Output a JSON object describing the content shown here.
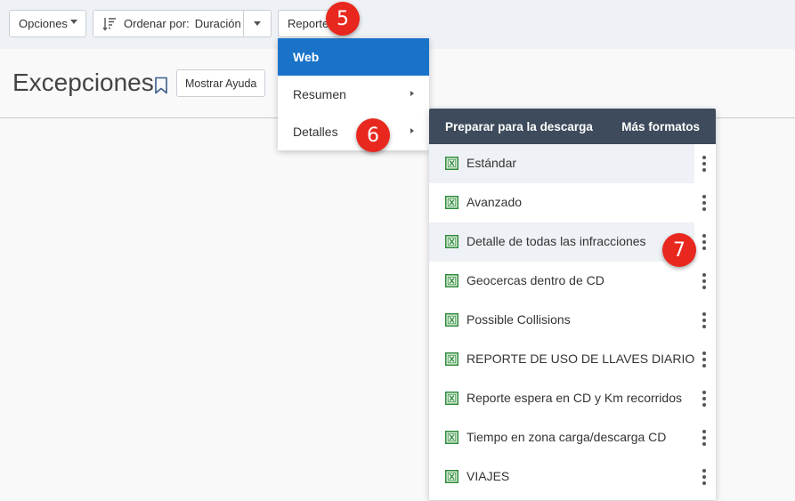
{
  "toolbar": {
    "opciones_label": "Opciones",
    "sort_prefix": "Ordenar por:",
    "sort_value": "Duración",
    "reportes_label": "Reportes"
  },
  "header": {
    "title": "Excepciones",
    "help_label": "Mostrar Ayuda"
  },
  "menu": {
    "items": [
      {
        "label": "Web"
      },
      {
        "label": "Resumen"
      },
      {
        "label": "Detalles"
      }
    ]
  },
  "submenu": {
    "header_left": "Preparar para la descarga",
    "header_right": "Más formatos",
    "items": [
      {
        "label": "Estándar"
      },
      {
        "label": "Avanzado"
      },
      {
        "label": "Detalle de todas las infracciones"
      },
      {
        "label": "Geocercas dentro de CD"
      },
      {
        "label": "Possible Collisions"
      },
      {
        "label": "REPORTE DE USO DE LLAVES DIARIO"
      },
      {
        "label": "Reporte espera en CD y Km recorridos"
      },
      {
        "label": "Tiempo en zona carga/descarga CD"
      },
      {
        "label": "VIAJES"
      }
    ]
  },
  "annotations": {
    "step5": "5",
    "step6": "6",
    "step7": "7"
  },
  "colors": {
    "accent": "#1a73c9",
    "submenu_header": "#3d4b5c",
    "badge": "#e8281e",
    "excel_icon": "#2e8b3a"
  }
}
